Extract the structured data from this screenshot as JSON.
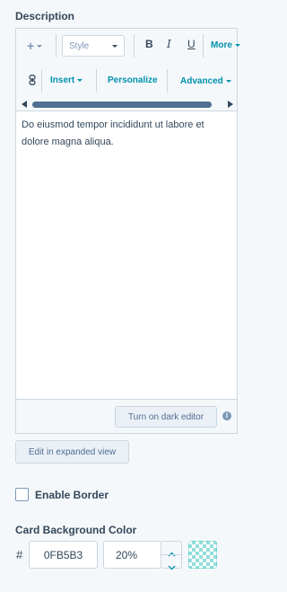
{
  "description_label": "Description",
  "toolbar": {
    "insert_icon": "plus-icon",
    "style_placeholder": "Style",
    "bold": "B",
    "italic": "I",
    "underline": "U",
    "more_label": "More",
    "link_icon": "link-icon",
    "insert_label": "Insert",
    "personalize_label": "Personalize",
    "advanced_label": "Advanced"
  },
  "editor": {
    "content": "Do eiusmod tempor incididunt ut labore et dolore magna aliqua.",
    "dark_editor_label": "Turn on dark editor"
  },
  "expanded_view_label": "Edit in expanded view",
  "border": {
    "label": "Enable Border",
    "checked": false
  },
  "background": {
    "label": "Card Background Color",
    "hash": "#",
    "hex_value": "0FB5B3",
    "opacity_value": "20%",
    "swatch_color": "#0FB5B3"
  },
  "colors": {
    "accent": "#0091ae",
    "text": "#33475b",
    "border": "#cbd6e2",
    "panel_bg": "#f5f8fa"
  }
}
